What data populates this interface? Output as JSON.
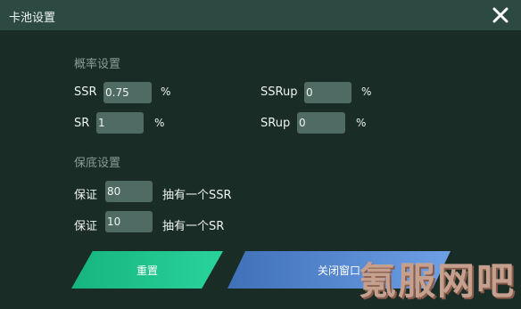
{
  "window": {
    "title": "卡池设置",
    "close_icon": "close-icon"
  },
  "probability": {
    "heading": "概率设置",
    "ssr": {
      "label": "SSR",
      "value": "0.75",
      "unit": "%"
    },
    "ssrup": {
      "label": "SSRup",
      "value": "0",
      "unit": "%"
    },
    "sr": {
      "label": "SR",
      "value": "1",
      "unit": "%"
    },
    "srup": {
      "label": "SRup",
      "value": "0",
      "unit": "%"
    }
  },
  "guarantee": {
    "heading": "保底设置",
    "rows": [
      {
        "label": "保证",
        "value": "80",
        "suffix": "抽有一个SSR"
      },
      {
        "label": "保证",
        "value": "10",
        "suffix": "抽有一个SR"
      }
    ]
  },
  "buttons": {
    "reset": "重置",
    "close": "关闭窗口"
  },
  "watermark": "氪服网吧",
  "colors": {
    "titlebar": "#2c4a42",
    "background": "#1a2c26",
    "reset": "#22c98f",
    "close": "#5a8bd6"
  }
}
